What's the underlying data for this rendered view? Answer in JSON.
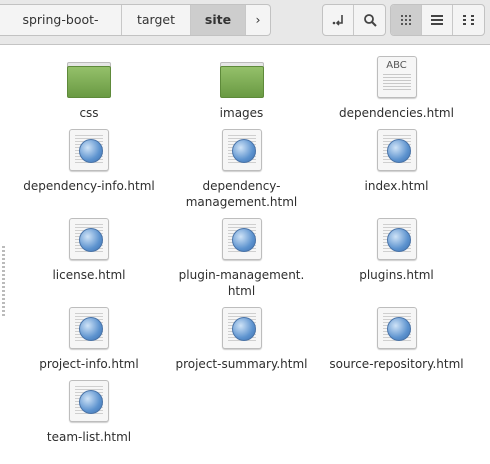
{
  "breadcrumb": [
    "spring-boot-aws",
    "target",
    "site"
  ],
  "breadcrumb_more": "›",
  "toolbar": {
    "buttons": [
      "open-parent-icon",
      "search-icon",
      "icon-view-icon",
      "list-view-icon",
      "compact-view-icon"
    ]
  },
  "files": [
    {
      "name": "css",
      "type": "folder"
    },
    {
      "name": "images",
      "type": "folder"
    },
    {
      "name": "dependencies.html",
      "type": "text",
      "preview": "ABC"
    },
    {
      "name": "dependency-info.html",
      "type": "html"
    },
    {
      "name": "dependency-management.html",
      "type": "html",
      "line1": "dependency-",
      "line2": "management.html"
    },
    {
      "name": "index.html",
      "type": "html"
    },
    {
      "name": "license.html",
      "type": "html"
    },
    {
      "name": "plugin-management.html",
      "type": "html",
      "line1": "plugin-management.",
      "line2": "html"
    },
    {
      "name": "plugins.html",
      "type": "html"
    },
    {
      "name": "project-info.html",
      "type": "html"
    },
    {
      "name": "project-summary.html",
      "type": "html"
    },
    {
      "name": "source-repository.html",
      "type": "html"
    },
    {
      "name": "team-list.html",
      "type": "html"
    }
  ]
}
